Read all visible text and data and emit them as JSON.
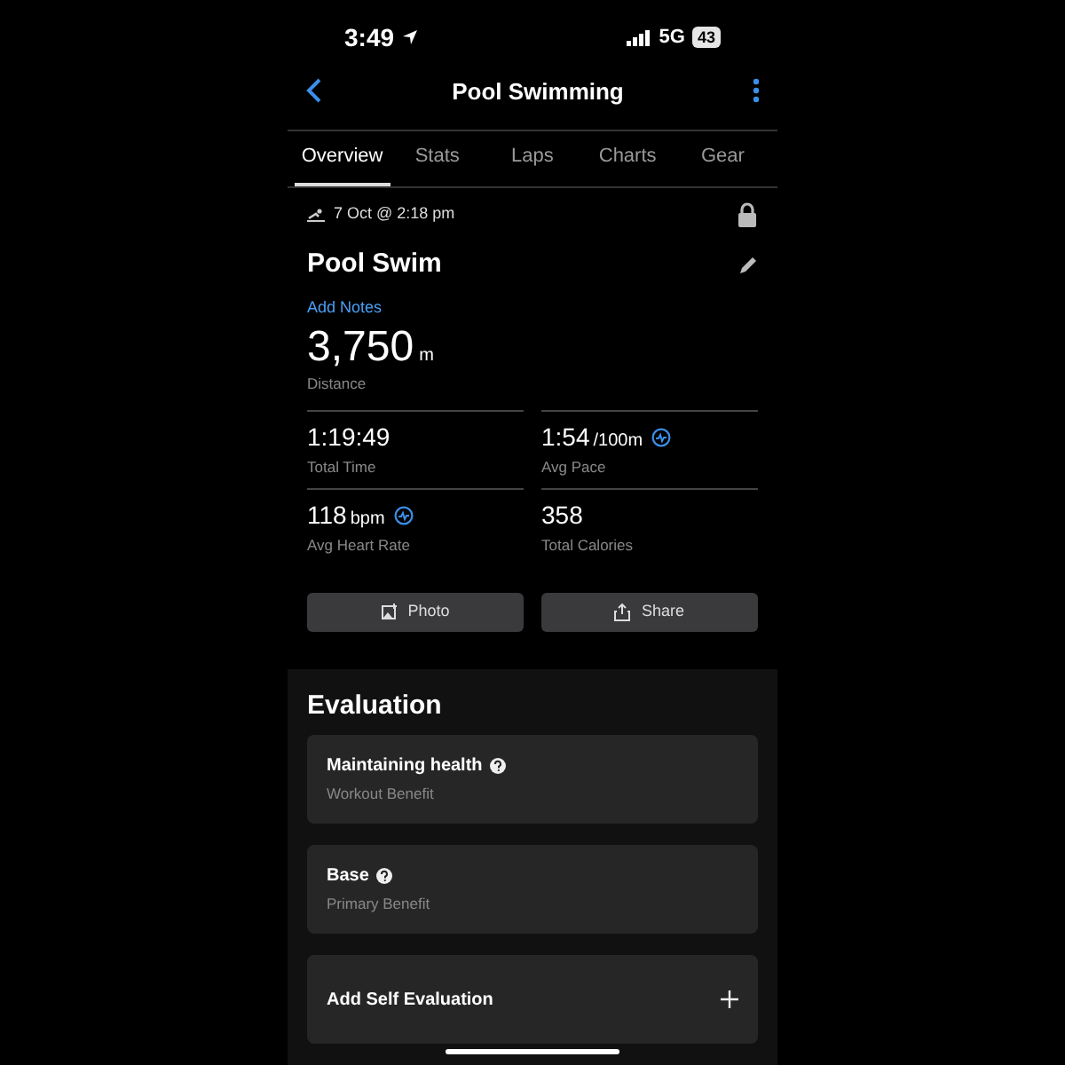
{
  "status_bar": {
    "time": "3:49",
    "network": "5G",
    "battery": "43"
  },
  "header": {
    "title": "Pool Swimming"
  },
  "tabs": [
    {
      "label": "Overview",
      "selected": true
    },
    {
      "label": "Stats",
      "selected": false
    },
    {
      "label": "Laps",
      "selected": false
    },
    {
      "label": "Charts",
      "selected": false
    },
    {
      "label": "Gear",
      "selected": false
    }
  ],
  "activity": {
    "date": "7 Oct @ 2:18 pm",
    "name": "Pool Swim",
    "notes_link": "Add Notes",
    "distance": {
      "value": "3,750",
      "unit": "m",
      "label": "Distance"
    }
  },
  "stats": [
    {
      "value": "1:19:49",
      "label": "Total Time",
      "badge": false
    },
    {
      "value": "1:54",
      "unit": "/100m",
      "label": "Avg Pace",
      "badge": true
    },
    {
      "value": "118",
      "unit": "bpm",
      "label": "Avg Heart Rate",
      "badge": true
    },
    {
      "value": "358",
      "label": "Total Calories",
      "badge": false
    }
  ],
  "buttons": [
    {
      "kind": "photo",
      "label": "Photo"
    },
    {
      "kind": "share",
      "label": "Share"
    }
  ],
  "evaluation": {
    "title": "Evaluation",
    "cards": [
      {
        "kind": "benefit",
        "title": "Maintaining health",
        "subtitle": "Workout Benefit"
      },
      {
        "kind": "benefit",
        "title": "Base",
        "subtitle": "Primary Benefit"
      },
      {
        "kind": "add",
        "title": "Add Self Evaluation"
      }
    ]
  }
}
